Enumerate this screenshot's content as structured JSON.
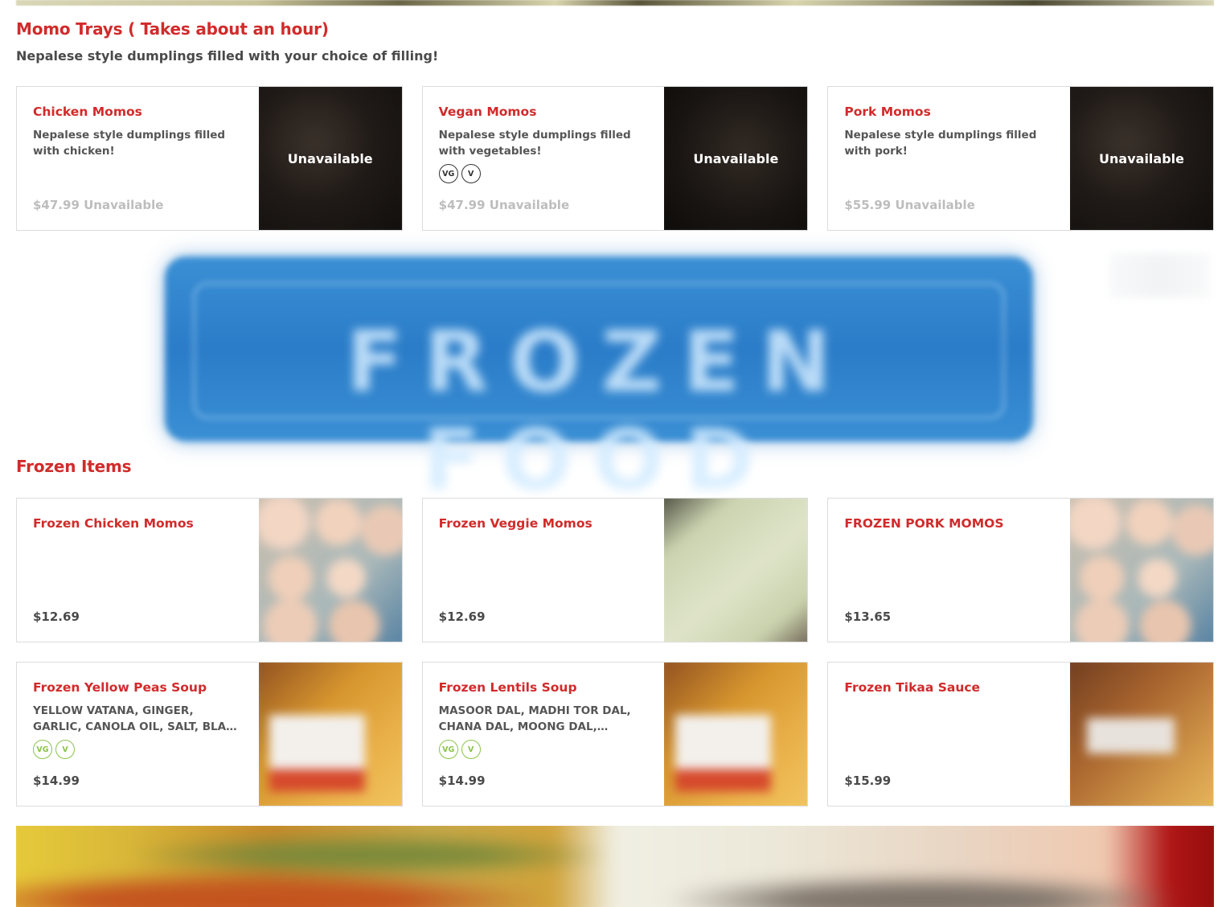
{
  "momo_trays": {
    "title": "Momo Trays ( Takes about an hour)",
    "description": "Nepalese style dumplings filled with your choice of filling!",
    "items": [
      {
        "name": "Chicken Momos",
        "description": "Nepalese style dumplings filled with chicken!",
        "price": "$47.99 Unavailable",
        "image_overlay": "Unavailable",
        "tags": []
      },
      {
        "name": "Vegan Momos",
        "description": "Nepalese style dumplings filled with vegetables!",
        "price": "$47.99 Unavailable",
        "image_overlay": "Unavailable",
        "tags": [
          "VG",
          "V"
        ]
      },
      {
        "name": "Pork Momos",
        "description": "Nepalese style dumplings filled with pork!",
        "price": "$55.99 Unavailable",
        "image_overlay": "Unavailable",
        "tags": []
      }
    ]
  },
  "frozen_items": {
    "title": "Frozen Items",
    "items": [
      {
        "name": "Frozen Chicken Momos",
        "description": "",
        "price": "$12.69",
        "tags": []
      },
      {
        "name": "Frozen Veggie Momos",
        "description": "",
        "price": "$12.69",
        "tags": []
      },
      {
        "name": "FROZEN PORK MOMOS",
        "description": "",
        "price": "$13.65",
        "tags": []
      },
      {
        "name": "Frozen Yellow Peas Soup",
        "description": "YELLOW VATANA, GINGER, GARLIC, CANOLA OIL, SALT, BLACK PEPPER,...",
        "price": "$14.99",
        "tags": [
          "VG",
          "V"
        ]
      },
      {
        "name": "Frozen Lentils Soup",
        "description": "MASOOR DAL, MADHI TOR DAL, CHANA DAL, MOONG DAL, URIDDAL, GINGER,...",
        "price": "$14.99",
        "tags": [
          "VG",
          "V"
        ]
      },
      {
        "name": "Frozen Tikaa Sauce",
        "description": "",
        "price": "$15.99",
        "tags": []
      }
    ]
  },
  "frozen_banner": {
    "text": "FROZEN FOOD"
  },
  "colors": {
    "accent": "#d12b2b",
    "tag_dark": "#333333",
    "tag_green": "#8bc34a",
    "unavailable_price": "#bdbdbd"
  },
  "icons": [
    "vegan-tag-icon",
    "vegetarian-tag-icon"
  ]
}
